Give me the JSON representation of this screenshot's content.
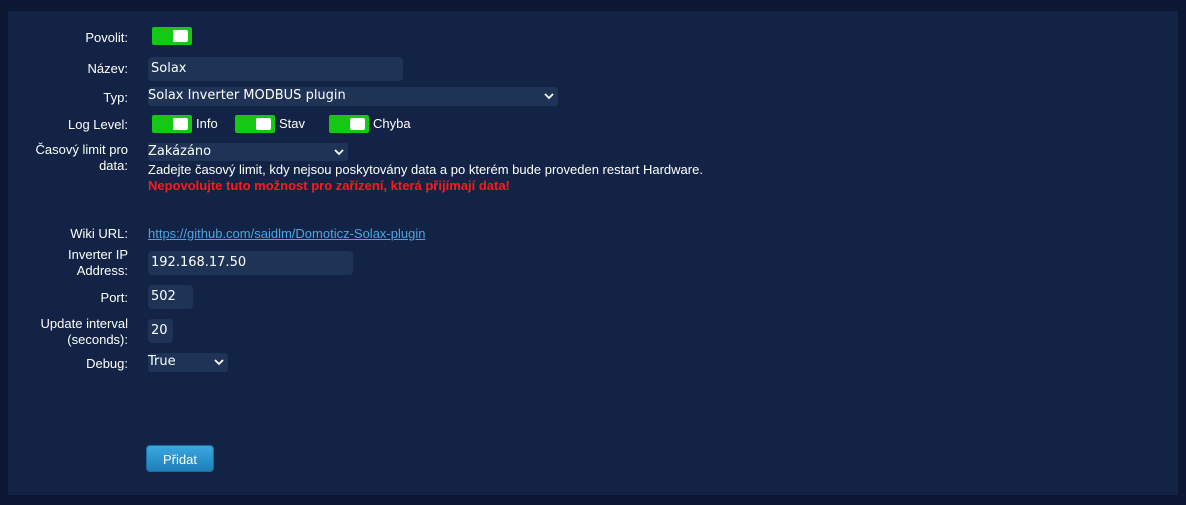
{
  "form": {
    "enable": {
      "label": "Povolit:",
      "on": true
    },
    "name": {
      "label": "Název:",
      "value": "Solax"
    },
    "type": {
      "label": "Typ:",
      "selected": "Solax Inverter MODBUS plugin"
    },
    "log_level": {
      "label": "Log Level:",
      "options": [
        {
          "label": "Info",
          "on": true
        },
        {
          "label": "Stav",
          "on": true
        },
        {
          "label": "Chyba",
          "on": true
        }
      ]
    },
    "timeout": {
      "label_line1": "Časový limit pro",
      "label_line2": "data:",
      "selected": "Zakázáno",
      "hint": "Zadejte časový limit, kdy nejsou poskytovány data a po kterém bude proveden restart Hardware.",
      "warning": "Nepovolujte tuto možnost pro zařízení, která přijímají data!"
    },
    "wiki": {
      "label": "Wiki URL:",
      "url": "https://github.com/saidlm/Domoticz-Solax-plugin"
    },
    "ip": {
      "label_line1": "Inverter IP",
      "label_line2": "Address:",
      "value": "192.168.17.50"
    },
    "port": {
      "label": "Port:",
      "value": "502"
    },
    "interval": {
      "label_line1": "Update interval",
      "label_line2": "(seconds):",
      "value": "20"
    },
    "debug": {
      "label": "Debug:",
      "selected": "True"
    },
    "submit_label": "Přidat"
  },
  "colors": {
    "background": "#0b1733",
    "panel": "#122345",
    "toggle_on": "#14c814",
    "warning": "#ff1a1a",
    "link": "#4fa3e0",
    "button": "#2a93cf"
  }
}
